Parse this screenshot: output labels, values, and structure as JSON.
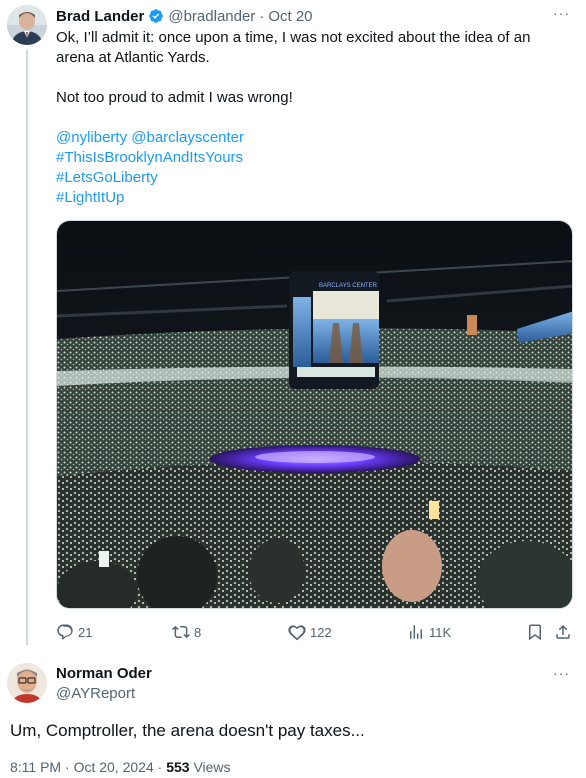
{
  "tweet": {
    "author_name": "Brad Lander",
    "handle": "@bradlander",
    "separator": "·",
    "date": "Oct 20",
    "more": "···",
    "text_lines": [
      "Ok, I’ll admit it: once upon a time, I was not excited about the idea of an",
      "arena at Atlantic Yards."
    ],
    "text_2": "Not too proud to admit I was wrong!",
    "mentions": "@nyliberty @barclayscenter",
    "hashtags": [
      "#ThisIsBrooklynAndItsYours",
      "#LetsGoLiberty",
      "#LightItUp"
    ],
    "media": {
      "scoreboard_text": "BARCLAYS CENTER",
      "accent_green": "#7be3a9",
      "court_purple": "#6a3cff"
    },
    "stats": {
      "replies": "21",
      "reposts": "8",
      "likes": "122",
      "views": "11K"
    }
  },
  "reply": {
    "author_name": "Norman Oder",
    "handle": "@AYReport",
    "more": "···",
    "text": "Um, Comptroller, the arena doesn't pay taxes...",
    "time": "8:11 PM",
    "separator": "·",
    "date": "Oct 20, 2024",
    "views_count": "553",
    "views_label": "Views"
  },
  "colors": {
    "link": "#1d9bf0",
    "secondary_text": "#536471",
    "verified_badge": "#1d9bf0",
    "thread_line": "#cfd9de"
  }
}
